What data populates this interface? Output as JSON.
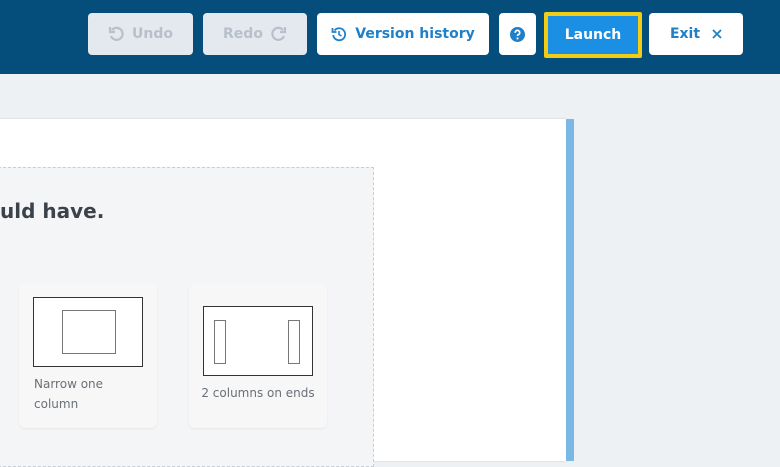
{
  "toolbar": {
    "undo_label": "Undo",
    "redo_label": "Redo",
    "version_history_label": "Version history",
    "help_icon": "question-circle-icon",
    "launch_label": "Launch",
    "exit_label": "Exit"
  },
  "colors": {
    "topbar": "#054e7c",
    "accent": "#1a8fe3",
    "highlight_border": "#f2cd15",
    "disabled_bg": "#e4e8ef"
  },
  "editor": {
    "question_text": "uld have.",
    "options": [
      {
        "label": "Narrow one column"
      },
      {
        "label": "2 columns on ends"
      }
    ]
  }
}
